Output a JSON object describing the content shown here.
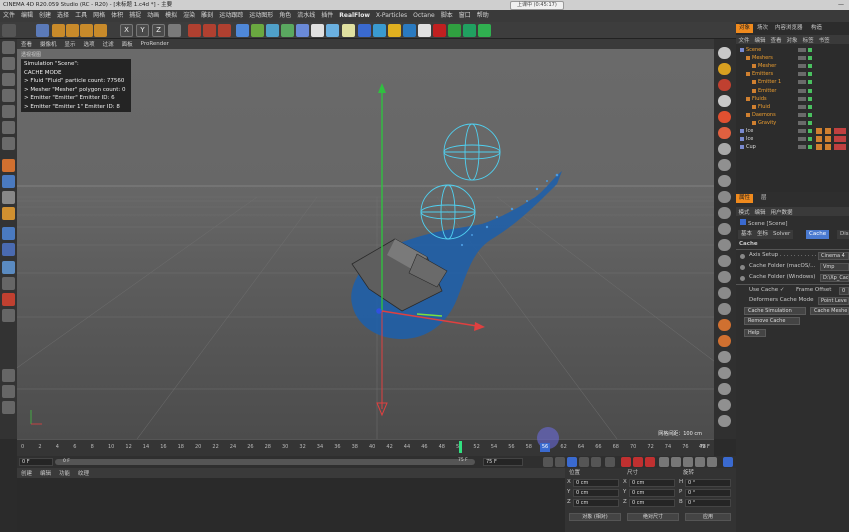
{
  "window": {
    "title": "CINEMA 4D R20.059 Studio (RC - R20) - [未标题 1.c4d *] - 主要",
    "notice": "上课中 (0:45:17)",
    "minimize": "—"
  },
  "menubar": {
    "items": [
      "文件",
      "编辑",
      "创建",
      "选择",
      "工具",
      "网格",
      "体积",
      "捕捉",
      "动画",
      "模拟",
      "渲染",
      "雕刻",
      "运动跟踪",
      "运动图形",
      "角色",
      "流水线",
      "插件",
      "RealFlow",
      "X-Particles",
      "Octane",
      "脚本",
      "窗口",
      "帮助"
    ]
  },
  "toolbar": {
    "axis_labels": [
      "X",
      "Y",
      "Z"
    ]
  },
  "viewport": {
    "menu": [
      "查看",
      "摄像机",
      "显示",
      "选项",
      "过滤",
      "面板",
      "ProRender"
    ],
    "label": "透视视图",
    "overlay": [
      "Simulation \"Scene\":",
      "CACHE MODE",
      "> Fluid \"Fluid\" particle count: 77560",
      "> Mesher \"Mesher\" polygon count: 0",
      "> Emitter \"Emitter\" Emitter ID: 6",
      "> Emitter \"Emitter 1\" Emitter ID: 8"
    ],
    "grid_info": "网格间距：100 cm"
  },
  "timeline": {
    "ticks": [
      "0",
      "2",
      "4",
      "6",
      "8",
      "10",
      "12",
      "14",
      "16",
      "18",
      "20",
      "22",
      "24",
      "26",
      "28",
      "30",
      "32",
      "34",
      "36",
      "38",
      "40",
      "42",
      "44",
      "46",
      "48",
      "50",
      "52",
      "54",
      "56",
      "58",
      "60",
      "62",
      "64",
      "66",
      "68",
      "70",
      "72",
      "74",
      "76",
      "78"
    ],
    "current_frame_label": "56",
    "end_label": "49 F"
  },
  "playbar": {
    "start_frame": "0 F",
    "range_start": "0 F",
    "range_end": "75 F",
    "end_frame": "75 F"
  },
  "bottom_panel": {
    "menu": [
      "创建",
      "编辑",
      "功能",
      "纹理"
    ]
  },
  "coord_panel": {
    "headers": [
      "位置",
      "尺寸",
      "旋转"
    ],
    "rows": [
      {
        "axis1": "X",
        "pos": "0 cm",
        "axis2": "X",
        "size": "0 cm",
        "axis3": "H",
        "rot": "0 °"
      },
      {
        "axis1": "Y",
        "pos": "0 cm",
        "axis2": "Y",
        "size": "0 cm",
        "axis3": "P",
        "rot": "0 °"
      },
      {
        "axis1": "Z",
        "pos": "0 cm",
        "axis2": "Z",
        "size": "0 cm",
        "axis3": "B",
        "rot": "0 °"
      }
    ],
    "mode_select": "对象 (相对)",
    "size_select": "绝对尺寸",
    "apply_button": "应用"
  },
  "object_manager": {
    "tabs": [
      "对象",
      "场次",
      "内容浏览器",
      "构造"
    ],
    "menu": [
      "文件",
      "编辑",
      "查看",
      "对象",
      "标签",
      "书签"
    ],
    "items": [
      {
        "name": "Scene",
        "indent": 0
      },
      {
        "name": "Meshers",
        "indent": 1
      },
      {
        "name": "Mesher",
        "indent": 2
      },
      {
        "name": "Emitters",
        "indent": 1
      },
      {
        "name": "Emitter 1",
        "indent": 2
      },
      {
        "name": "Emitter",
        "indent": 2
      },
      {
        "name": "Fluids",
        "indent": 1
      },
      {
        "name": "Fluid",
        "indent": 2
      },
      {
        "name": "Daemons",
        "indent": 1
      },
      {
        "name": "Gravity",
        "indent": 2
      },
      {
        "name": "Ice",
        "indent": 0
      },
      {
        "name": "Ice",
        "indent": 0
      },
      {
        "name": "Cup",
        "indent": 0
      }
    ]
  },
  "attribute_manager": {
    "tabs": [
      "属性",
      "层"
    ],
    "menu": [
      "模式",
      "编辑",
      "用户数据"
    ],
    "object_name": "Scene [Scene]",
    "subtabs": [
      "基本",
      "坐标",
      "Solver",
      "Cache",
      "Displ"
    ],
    "section": "Cache",
    "axis_setup_label": "Axis Setup . . . . . . . . . . . . .",
    "axis_setup_value": "Cinema 4",
    "cache_folder_mac_label": "Cache Folder (macOS/...",
    "cache_folder_mac_value": "Vmp",
    "cache_folder_win_label": "Cache Folder (Windows)",
    "cache_folder_win_value": "D:\\Xp_Cach",
    "use_cache_label": "Use Cache ✓",
    "frame_offset_label": "Frame Offset",
    "frame_offset_value": "0",
    "deformers_cache_label": "Deformers Cache Mode",
    "deformers_cache_value": "Point Leve",
    "cache_sim_button": "Cache Simulation",
    "cache_meshes_button": "Cache Meshe",
    "remove_cache_button": "Remove Cache",
    "help_button": "Help"
  }
}
